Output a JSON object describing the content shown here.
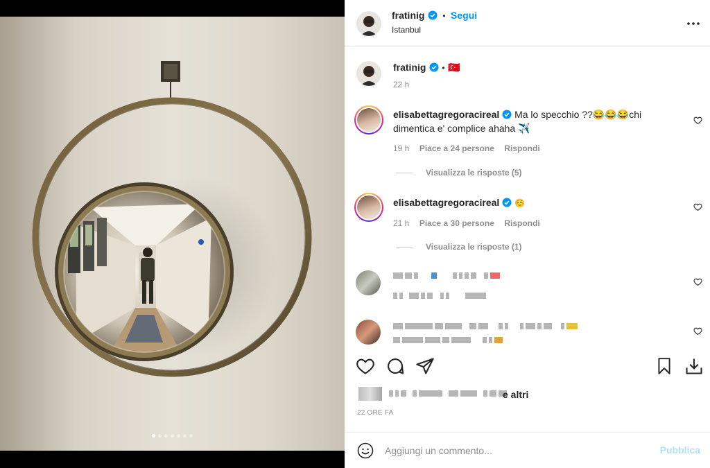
{
  "post": {
    "username": "fratinig",
    "follow_label": "Segui",
    "location": "Istanbul",
    "more_icon": "more-horizontal-icon",
    "caption": {
      "username": "fratinig",
      "separator": "•",
      "flag": "🇹🇷",
      "time": "22 h"
    },
    "carousel": {
      "count": 7,
      "active": 1
    }
  },
  "comments": [
    {
      "username": "elisabettagregoracireal",
      "text": "Ma lo specchio ??😂😂😂chi dimentica e' complice ahaha ✈️",
      "time": "19 h",
      "likes": "Piace a 24 persone",
      "reply": "Rispondi",
      "view_replies": "Visualizza le risposte (5)"
    },
    {
      "username": "elisabettagregoracireal",
      "text": "☺️",
      "time": "21 h",
      "likes": "Piace a 30 persone",
      "reply": "Rispondi",
      "view_replies": "Visualizza le risposte (1)"
    }
  ],
  "likes_summary": {
    "suffix": "e altri"
  },
  "post_date": "22 ORE FA",
  "comment_box": {
    "placeholder": "Aggiungi un commento...",
    "publish": "Pubblica"
  },
  "colors": {
    "accent": "#0095f6",
    "verified": "#0095f6",
    "publish_disabled": "#b2dffc",
    "text": "#262626",
    "muted": "#8e8e8e"
  }
}
